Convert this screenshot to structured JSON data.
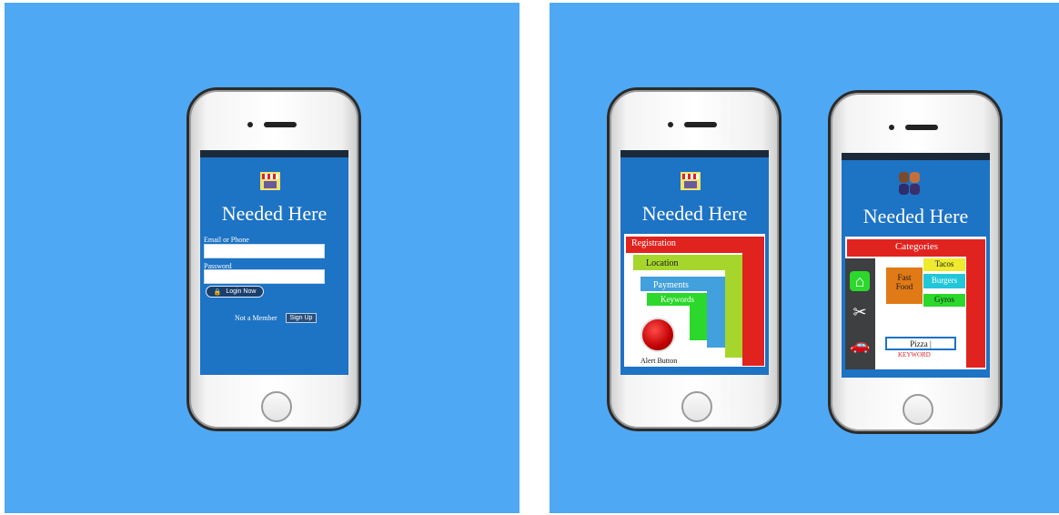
{
  "app": {
    "title": "Needed Here"
  },
  "login": {
    "email_label": "Email or Phone",
    "password_label": "Password",
    "login_button": "Login Now",
    "not_member": "Not a Member",
    "signup_button": "Sign Up"
  },
  "menu": {
    "registration": "Registration",
    "location": "Location",
    "payments": "Payments",
    "keywords": "Keywords",
    "alert_button": "Alert Button"
  },
  "categories": {
    "header": "Categories",
    "fast_food": "Fast Food",
    "tacos": "Tacos",
    "burgers": "Burgers",
    "gyros": "Gyros",
    "search_value": "Pizza |",
    "keyword_label": "KEYWORD"
  },
  "colors": {
    "background": "#4ea8f3",
    "screen": "#1d73c4",
    "red": "#e1231f",
    "lime": "#a6d62b",
    "lightblue": "#42a0dc",
    "green": "#2bd82b",
    "orange": "#e07a16",
    "yellow": "#efea2e",
    "cyan": "#21c7d9"
  },
  "icons": [
    "storefront-icon",
    "people-icon",
    "lock-icon",
    "home-icon",
    "scissors-icon",
    "car-icon"
  ]
}
